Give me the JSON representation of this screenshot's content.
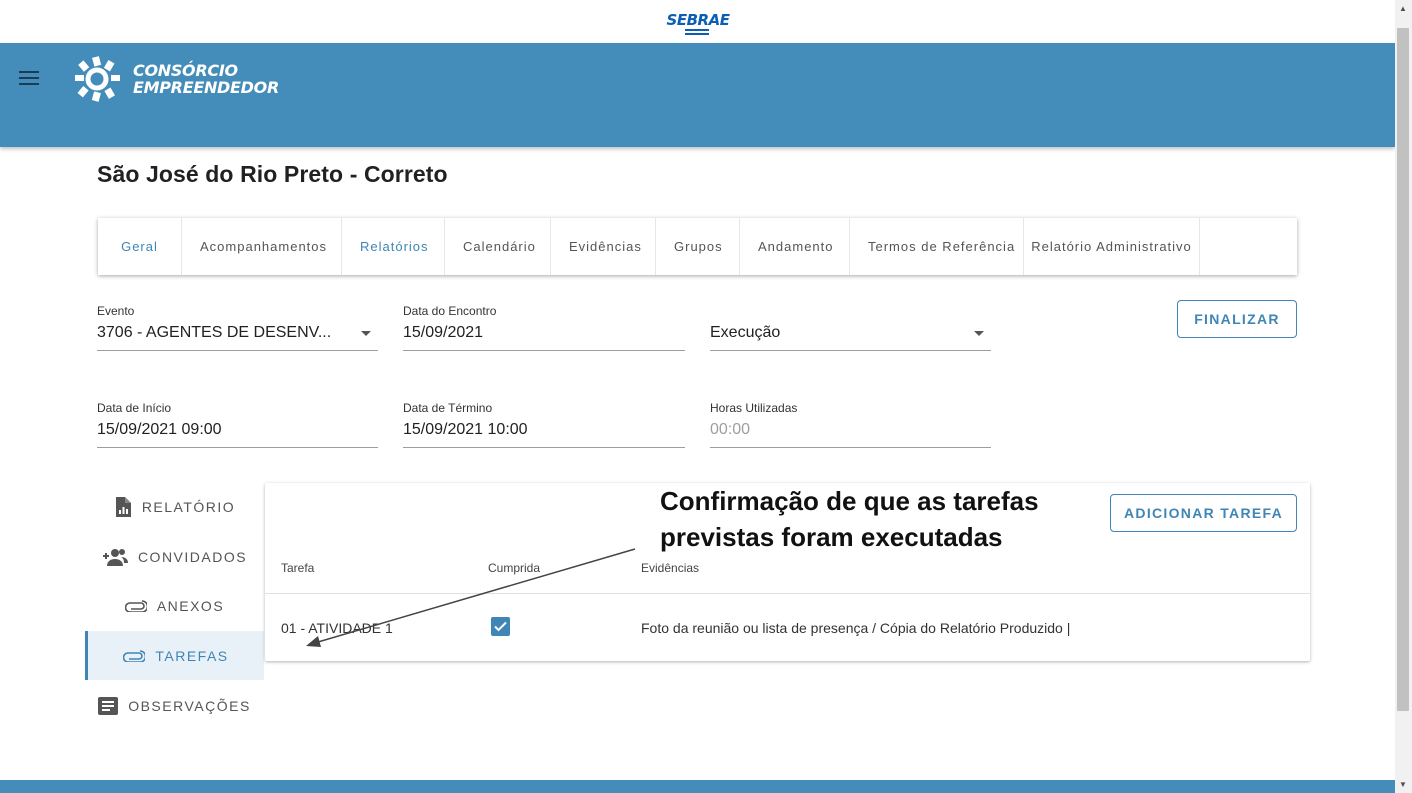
{
  "top": {
    "logo_text": "SEBRAE"
  },
  "header": {
    "brand_line1": "CONSÓRCIO",
    "brand_line2": "EMPREENDEDOR",
    "brand_color": "#448cb9"
  },
  "page": {
    "title": "São José do Rio Preto - Correto"
  },
  "tabs": [
    {
      "label": "Geral",
      "active": true
    },
    {
      "label": "Acompanhamentos",
      "active": false
    },
    {
      "label": "Relatórios",
      "active": true
    },
    {
      "label": "Calendário",
      "active": false
    },
    {
      "label": "Evidências",
      "active": false
    },
    {
      "label": "Grupos",
      "active": false
    },
    {
      "label": "Andamento",
      "active": false
    },
    {
      "label": "Termos de Referência",
      "active": false
    },
    {
      "label": "Relatório Administrativo",
      "active": false
    }
  ],
  "form": {
    "evento": {
      "label": "Evento",
      "value": "3706 - AGENTES DE DESENV..."
    },
    "data_encontro": {
      "label": "Data do Encontro",
      "value": "15/09/2021"
    },
    "status": {
      "value": "Execução"
    },
    "data_inicio": {
      "label": "Data de Início",
      "value": "15/09/2021 09:00"
    },
    "data_termino": {
      "label": "Data de Término",
      "value": "15/09/2021 10:00"
    },
    "horas": {
      "label": "Horas Utilizadas",
      "placeholder": "00:00"
    },
    "finalizar_label": "FINALIZAR"
  },
  "sidebar": {
    "items": [
      {
        "label": "RELATÓRIO",
        "icon": "report-file-icon",
        "active": false
      },
      {
        "label": "CONVIDADOS",
        "icon": "add-people-icon",
        "active": false
      },
      {
        "label": "ANEXOS",
        "icon": "paperclip-icon",
        "active": false
      },
      {
        "label": "TAREFAS",
        "icon": "paperclip-icon",
        "active": true
      },
      {
        "label": "OBSERVAÇÕES",
        "icon": "notes-icon",
        "active": false
      }
    ]
  },
  "tasks": {
    "add_label": "ADICIONAR TAREFA",
    "headers": {
      "task": "Tarefa",
      "done": "Cumprida",
      "evidence": "Evidências"
    },
    "rows": [
      {
        "task": "01 - ATIVIDADE 1",
        "done": true,
        "evidence": "Foto da reunião ou lista de presença / Cópia do Relatório Produzido |"
      }
    ]
  },
  "annotation": {
    "line1": "Confirmação de que as tarefas",
    "line2": "previstas  foram executadas"
  }
}
